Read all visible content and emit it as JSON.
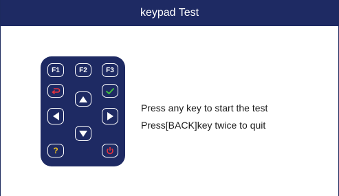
{
  "header": {
    "title": "keypad  Test"
  },
  "keypad": {
    "f1": "F1",
    "f2": "F2",
    "f3": "F3",
    "help": "?",
    "icons": {
      "back": "back-arrow-icon",
      "ok": "checkmark-icon",
      "up": "up-triangle-icon",
      "down": "down-triangle-icon",
      "left": "left-triangle-icon",
      "right": "right-triangle-icon",
      "power": "power-icon"
    }
  },
  "instructions": {
    "line1": "Press any key to start the test",
    "line2": "Press[BACK]key twice to quit"
  },
  "colors": {
    "primary": "#1e2a63",
    "back_icon": "#e8323c",
    "ok_icon": "#3fbf3f",
    "help_icon": "#f2c21b",
    "power_icon": "#e8323c"
  }
}
